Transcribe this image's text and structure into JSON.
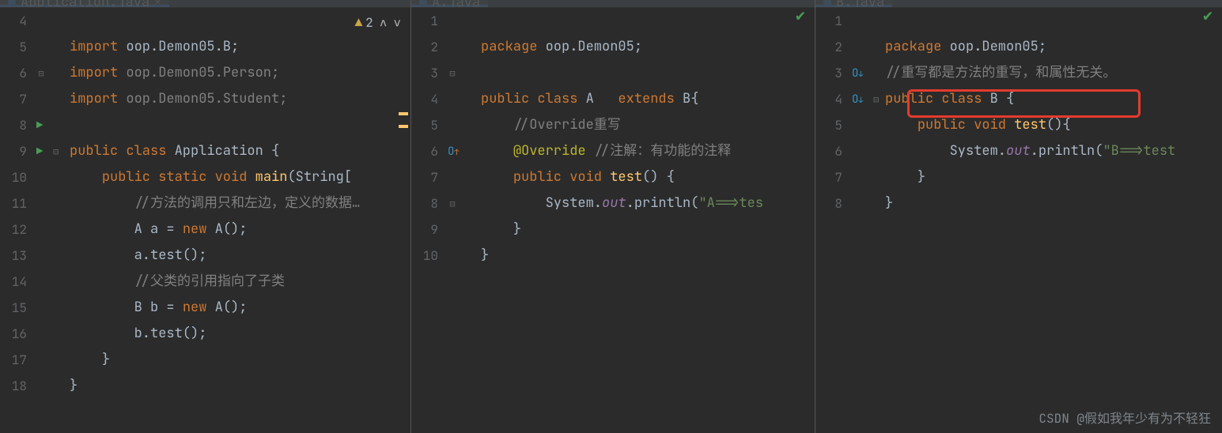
{
  "tabs": {
    "t1": "Application.java",
    "t2": "A.java",
    "t3": "B.java"
  },
  "warn_count": "2",
  "p1": {
    "lines": [
      "4",
      "5",
      "6",
      "7",
      "8",
      "9",
      "10",
      "11",
      "12",
      "13",
      "14",
      "15",
      "16",
      "17",
      "18"
    ],
    "l4a": "import ",
    "l4b": "oop.Demon05.B",
    "l5a": "import ",
    "l5b": "oop.Demon05.Person",
    "l6a": "import ",
    "l6b": "oop.Demon05.Student",
    "l8a": "public class ",
    "l8b": "Application ",
    "l8c": "{",
    "l9a": "public static void ",
    "l9b": "main",
    "l9c": "(",
    "l9d": "String[",
    "l10": "//方法的调用只和左边，定义的数据…",
    "l11a": "A a = ",
    "l11b": "new ",
    "l11c": "A();",
    "l12": "a.test();",
    "l13": "//父类的引用指向了子类",
    "l14a": "B b = ",
    "l14b": "new ",
    "l14c": "A();",
    "l15": "b.test();",
    "l16": "}",
    "l17": "}"
  },
  "p2": {
    "lines": [
      "1",
      "2",
      "3",
      "4",
      "5",
      "6",
      "7",
      "8",
      "9",
      "10"
    ],
    "l1a": "package ",
    "l1b": "oop.Demon05",
    "l3a": "public class ",
    "l3b": "A   ",
    "l3c": "extends ",
    "l3d": "B",
    "l3e": "{",
    "l4": "//Override重写",
    "l5a": "@Override",
    "l5b": " //注解：有功能的注释",
    "l6a": "public void ",
    "l6b": "test",
    "l6c": "() {",
    "l7a": "System.",
    "l7b": "out",
    "l7c": ".println(",
    "l7d": "\"A==>tes",
    "l8": "}",
    "l9": "}"
  },
  "p3": {
    "lines": [
      "1",
      "2",
      "3",
      "4",
      "5",
      "6",
      "7",
      "8"
    ],
    "l1a": "package ",
    "l1b": "oop.Demon05",
    "l2": "//重写都是方法的重写，和属性无关。",
    "l3a": "public class ",
    "l3b": "B ",
    "l3c": "{",
    "l4a": "public void ",
    "l4b": "test",
    "l4c": "(){",
    "l5a": "System.",
    "l5b": "out",
    "l5c": ".println(",
    "l5d": "\"B==>test",
    "l6": "}",
    "l7": "}"
  },
  "watermark": "CSDN @假如我年少有为不轻狂"
}
